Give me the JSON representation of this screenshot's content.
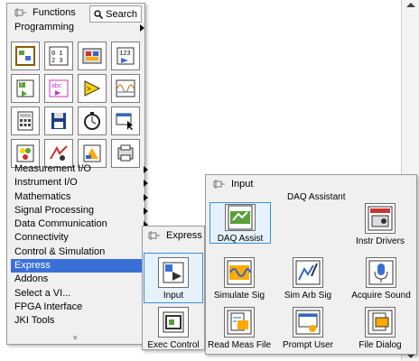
{
  "functions_palette": {
    "title": "Functions",
    "search_label": "Search",
    "category": "Programming",
    "icons": [
      "cluster-icon",
      "array-icon",
      "data-bundle-icon",
      "numeric-icon",
      "boolean-icon",
      "string-icon",
      "comparison-icon",
      "waveform-icon",
      "timing-icon",
      "file-io-icon",
      "dialog-icon",
      "cursor-icon",
      "structures-icon",
      "sync-icon",
      "graphics-icon",
      "report-icon"
    ],
    "menu_items": [
      {
        "label": "Measurement I/O",
        "submenu": true
      },
      {
        "label": "Instrument I/O",
        "submenu": true
      },
      {
        "label": "Mathematics",
        "submenu": true
      },
      {
        "label": "Signal Processing",
        "submenu": true
      },
      {
        "label": "Data Communication",
        "submenu": true
      },
      {
        "label": "Connectivity",
        "submenu": true
      },
      {
        "label": "Control & Simulation",
        "submenu": true
      },
      {
        "label": "Express",
        "submenu": true,
        "selected": true
      },
      {
        "label": "Addons",
        "submenu": true
      },
      {
        "label": "Select a VI...",
        "submenu": false
      },
      {
        "label": "FPGA Interface",
        "submenu": true
      },
      {
        "label": "JKI Tools",
        "submenu": true
      }
    ],
    "expand_glyph": "»"
  },
  "express_palette": {
    "title": "Express",
    "items": [
      {
        "label": "Input",
        "icon": "input-icon",
        "selected": true
      },
      {
        "label": "Exec Control",
        "icon": "exec-control-icon"
      }
    ]
  },
  "input_palette": {
    "title": "Input",
    "hover_caption": "DAQ Assistant",
    "items": [
      {
        "label": "DAQ Assist",
        "icon": "daq-assist-icon",
        "selected": true
      },
      {
        "label": "Instr Drivers",
        "icon": "instr-drivers-icon"
      },
      {
        "label": "Simulate Sig",
        "icon": "simulate-signal-icon"
      },
      {
        "label": "Sim Arb Sig",
        "icon": "sim-arb-signal-icon"
      },
      {
        "label": "Acquire Sound",
        "icon": "microphone-icon"
      },
      {
        "label": "Read Meas File",
        "icon": "read-file-icon"
      },
      {
        "label": "Prompt User",
        "icon": "prompt-user-icon"
      },
      {
        "label": "File Dialog",
        "icon": "file-dialog-icon"
      }
    ]
  },
  "colors": {
    "selection": "#3a6fd8",
    "panel_bg": "#f0f0f0",
    "hover_bg": "#e5f1fb",
    "hover_border": "#3a8fd8"
  }
}
